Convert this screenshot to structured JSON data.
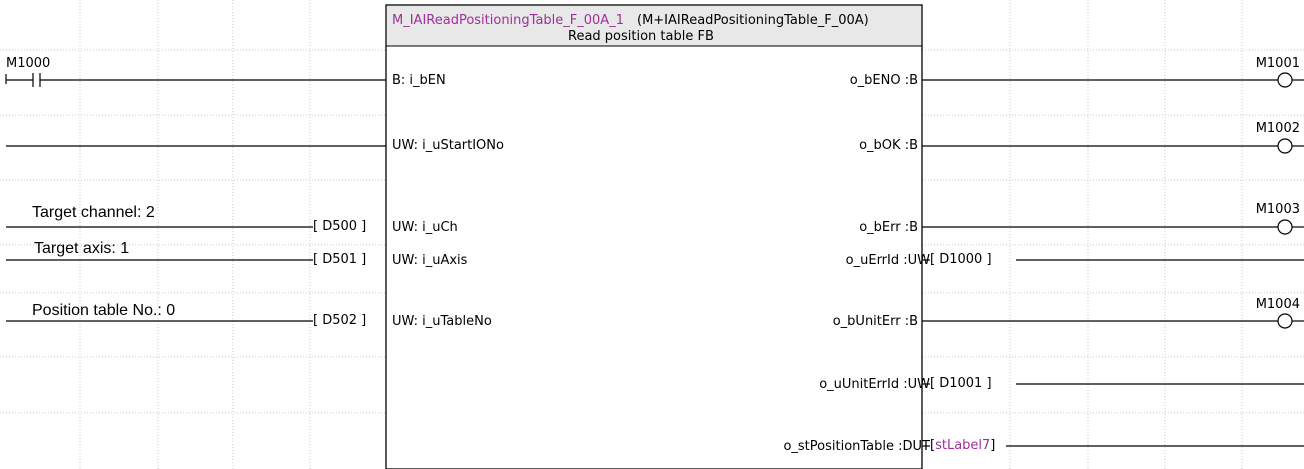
{
  "fb": {
    "instance": "M_IAIReadPositioningTable_F_00A_1",
    "type": "(M+IAIReadPositioningTable_F_00A)",
    "description": "Read position table FB",
    "inputs": [
      "B: i_bEN",
      "UW: i_uStartIONo",
      "UW: i_uCh",
      "UW: i_uAxis",
      "UW: i_uTableNo"
    ],
    "outputs": [
      "o_bENO :B",
      "o_bOK :B",
      "o_bErr :B",
      "o_uErrId :UW",
      "o_bUnitErr :B",
      "o_uUnitErrId :UW",
      "o_stPositionTable :DUT"
    ]
  },
  "left": {
    "contact": "M1000",
    "comments": [
      "Target channel: 2",
      "Target axis: 1",
      "Position table No.: 0"
    ],
    "devices": [
      "D500",
      "D501",
      "D502"
    ]
  },
  "right": {
    "coils": [
      "M1001",
      "M1002",
      "M1003",
      "M1004"
    ],
    "devices": [
      "D1000",
      "D1001",
      "stLabel7"
    ]
  },
  "colors": {
    "magenta": "#a0309a",
    "grid": "#c8c8c8",
    "header": "#e8e8e8"
  }
}
